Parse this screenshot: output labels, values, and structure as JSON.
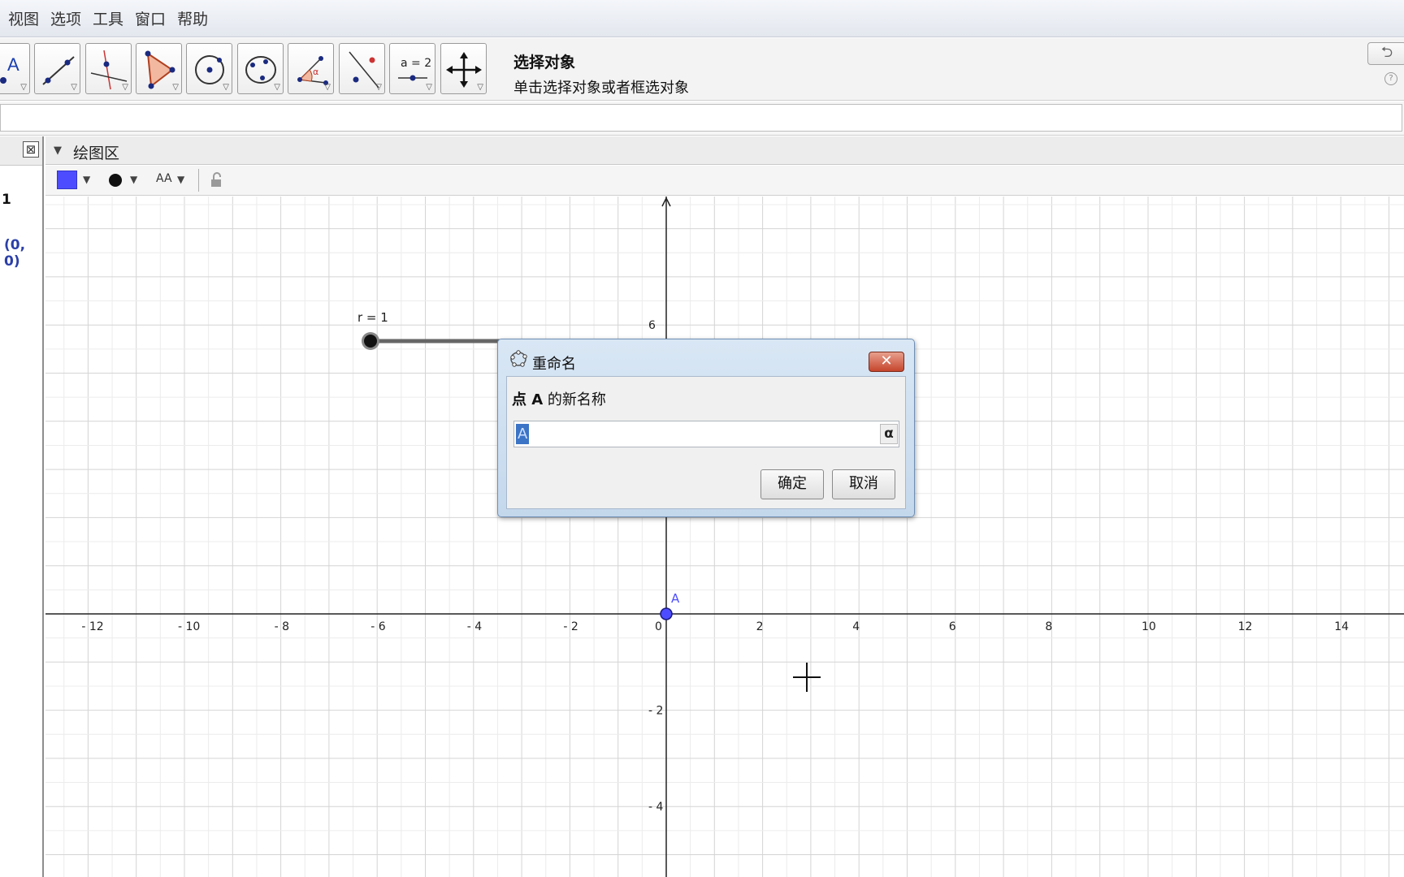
{
  "menu": [
    "视图",
    "选项",
    "工具",
    "窗口",
    "帮助"
  ],
  "toolbar": {
    "tools": [
      {
        "name": "move-tool",
        "icon": "cursor-a-icon"
      },
      {
        "name": "line-tool",
        "icon": "line-through-points-icon"
      },
      {
        "name": "perpendicular-tool",
        "icon": "perpendicular-line-icon"
      },
      {
        "name": "polygon-tool",
        "icon": "polygon-icon"
      },
      {
        "name": "circle-tool",
        "icon": "circle-center-point-icon"
      },
      {
        "name": "conic-tool",
        "icon": "ellipse-icon"
      },
      {
        "name": "angle-tool",
        "icon": "angle-icon"
      },
      {
        "name": "reflect-tool",
        "icon": "reflect-line-icon"
      },
      {
        "name": "slider-tool",
        "icon": "slider-icon",
        "label": "a = 2"
      },
      {
        "name": "move-view-tool",
        "icon": "move-arrows-icon"
      }
    ],
    "help_title": "选择对象",
    "help_text": "单击选择对象或者框选对象",
    "undo_icon": "undo-icon",
    "help_icon_label": "?"
  },
  "algebra": {
    "item1": "1",
    "item2": "(0, 0)"
  },
  "graphics": {
    "title": "绘图区",
    "swatch_color": "#4d4dff",
    "text_size_label": "AA",
    "slider_label": "r = 1",
    "point_label": "A",
    "x_ticks": [
      "- 12",
      "- 10",
      "- 8",
      "- 6",
      "- 4",
      "- 2",
      "0",
      "2",
      "4",
      "6",
      "8",
      "10",
      "12",
      "14"
    ],
    "y_ticks": [
      "6",
      "- 2",
      "- 4"
    ]
  },
  "dialog": {
    "title": "重命名",
    "prompt_bold": "点 A",
    "prompt_rest": " 的新名称",
    "input_value": "A",
    "alpha_label": "α",
    "ok_label": "确定",
    "cancel_label": "取消",
    "close_label": "✕"
  }
}
